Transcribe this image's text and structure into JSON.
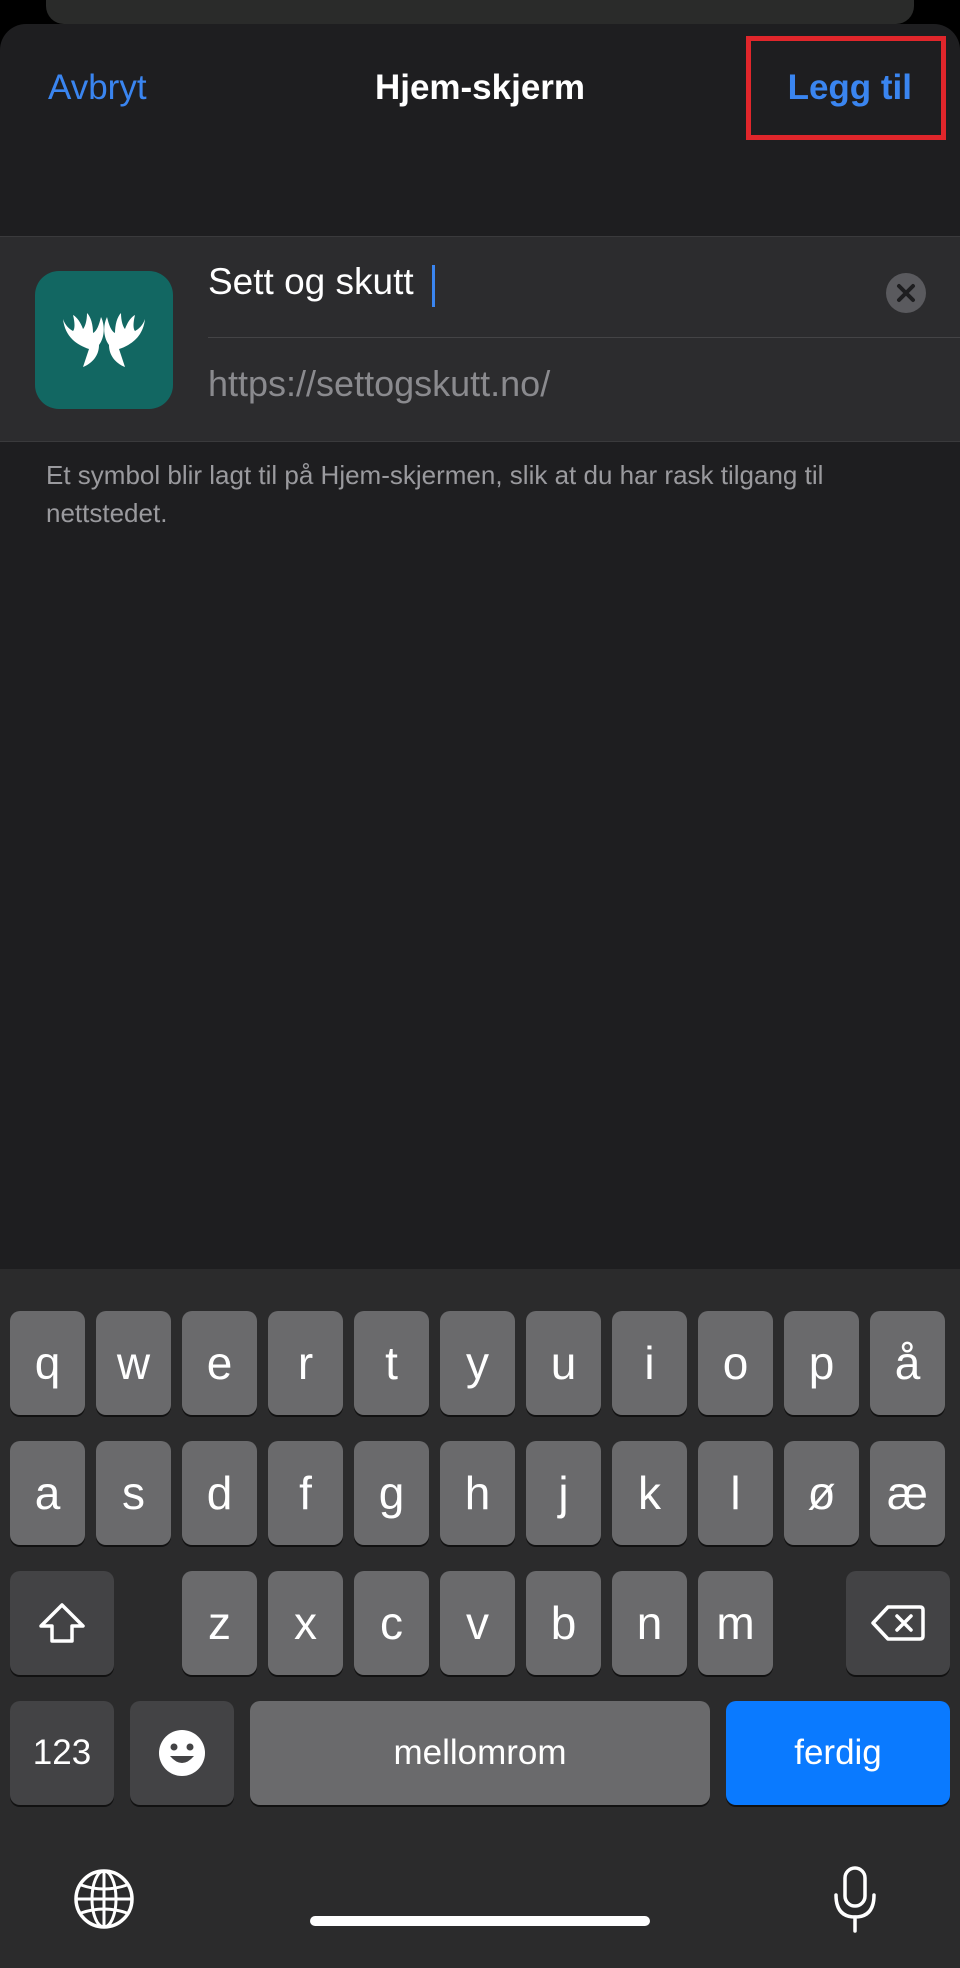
{
  "nav": {
    "cancel": "Avbryt",
    "title": "Hjem-skjerm",
    "add": "Legg til"
  },
  "bookmark": {
    "name": "Sett og skutt",
    "url": "https://settogskutt.no/",
    "icon": "moose-antlers-icon",
    "icon_color": "#126762"
  },
  "footnote": "Et symbol blir lagt til på Hjem-skjermen, slik at du har rask tilgang til nettstedet.",
  "keyboard": {
    "row1": [
      "q",
      "w",
      "e",
      "r",
      "t",
      "y",
      "u",
      "i",
      "o",
      "p",
      "å"
    ],
    "row2": [
      "a",
      "s",
      "d",
      "f",
      "g",
      "h",
      "j",
      "k",
      "l",
      "ø",
      "æ"
    ],
    "row3": [
      "z",
      "x",
      "c",
      "v",
      "b",
      "n",
      "m"
    ],
    "numbers": "123",
    "space": "mellomrom",
    "done": "ferdig",
    "done_color": "#0a7aff"
  },
  "colors": {
    "accent": "#3a85f0",
    "highlight": "#e0262b"
  }
}
